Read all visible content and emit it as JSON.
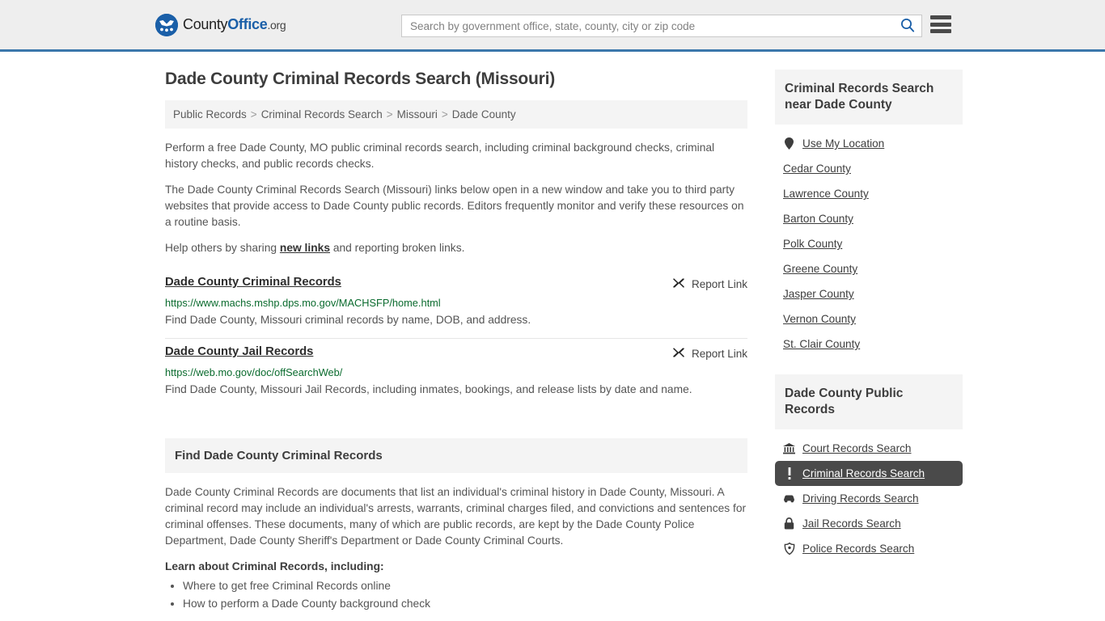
{
  "header": {
    "logo": {
      "name_part1": "County",
      "name_part2": "Office",
      "name_part3": ".org",
      "brand_color": "#1a5fa8"
    },
    "search": {
      "placeholder": "Search by government office, state, county, city or zip code",
      "value": "",
      "icon": "search-icon"
    },
    "menu_icon": "hamburger-menu-icon",
    "accent_border_color": "#3b77ab"
  },
  "main": {
    "title": "Dade County Criminal Records Search (Missouri)",
    "breadcrumb": [
      "Public Records",
      "Criminal Records Search",
      "Missouri",
      "Dade County"
    ],
    "breadcrumb_separator": ">",
    "intro_paragraphs": [
      "Perform a free Dade County, MO public criminal records search, including criminal background checks, criminal history checks, and public records checks.",
      "The Dade County Criminal Records Search (Missouri) links below open in a new window and take you to third party websites that provide access to Dade County public records. Editors frequently monitor and verify these resources on a routine basis."
    ],
    "share_line": {
      "before": "Help others by sharing ",
      "link": "new links",
      "after": " and reporting broken links."
    },
    "report_link_label": "Report Link",
    "report_link_icon": "broken-link-icon",
    "links": [
      {
        "title": "Dade County Criminal Records",
        "url": "https://www.machs.mshp.dps.mo.gov/MACHSFP/home.html",
        "description": "Find Dade County, Missouri criminal records by name, DOB, and address."
      },
      {
        "title": "Dade County Jail Records",
        "url": "https://web.mo.gov/doc/offSearchWeb/",
        "description": "Find Dade County, Missouri Jail Records, including inmates, bookings, and release lists by date and name."
      }
    ],
    "info": {
      "heading": "Find Dade County Criminal Records",
      "paragraph": "Dade County Criminal Records are documents that list an individual's criminal history in Dade County, Missouri. A criminal record may include an individual's arrests, warrants, criminal charges filed, and convictions and sentences for criminal offenses. These documents, many of which are public records, are kept by the Dade County Police Department, Dade County Sheriff's Department or Dade County Criminal Courts.",
      "subheading": "Learn about Criminal Records, including:",
      "bullets": [
        "Where to get free Criminal Records online",
        "How to perform a Dade County background check"
      ]
    }
  },
  "sidebar": {
    "widgets": [
      {
        "heading": "Criminal Records Search near Dade County",
        "items": [
          {
            "label": "Use My Location",
            "icon": "map-pin-icon",
            "active": false
          },
          {
            "label": "Cedar County",
            "icon": "",
            "active": false
          },
          {
            "label": "Lawrence County",
            "icon": "",
            "active": false
          },
          {
            "label": "Barton County",
            "icon": "",
            "active": false
          },
          {
            "label": "Polk County",
            "icon": "",
            "active": false
          },
          {
            "label": "Greene County",
            "icon": "",
            "active": false
          },
          {
            "label": "Jasper County",
            "icon": "",
            "active": false
          },
          {
            "label": "Vernon County",
            "icon": "",
            "active": false
          },
          {
            "label": "St. Clair County",
            "icon": "",
            "active": false
          }
        ]
      },
      {
        "heading": "Dade County Public Records",
        "items": [
          {
            "label": "Court Records Search",
            "icon": "courthouse-icon",
            "active": false
          },
          {
            "label": "Criminal Records Search",
            "icon": "exclamation-icon",
            "active": true
          },
          {
            "label": "Driving Records Search",
            "icon": "car-icon",
            "active": false
          },
          {
            "label": "Jail Records Search",
            "icon": "lock-icon",
            "active": false
          },
          {
            "label": "Police Records Search",
            "icon": "police-badge-icon",
            "active": false
          }
        ]
      }
    ],
    "active_highlight_color": "#4a4a4a"
  }
}
